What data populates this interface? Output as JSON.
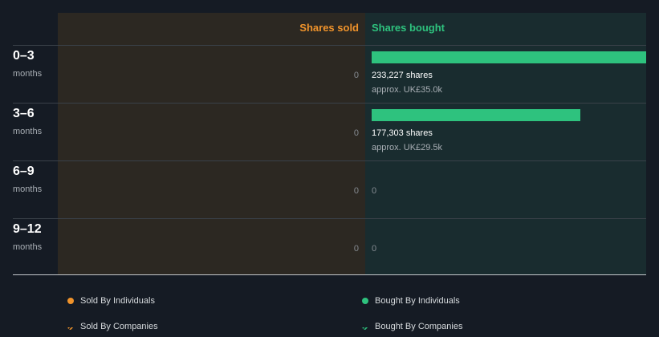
{
  "colors": {
    "sold": "#f0932b",
    "bought": "#2ec27e"
  },
  "chart_data": {
    "type": "bar",
    "orientation": "horizontal",
    "headers": {
      "sold": "Shares sold",
      "bought": "Shares bought"
    },
    "categories": [
      {
        "label": "0–3",
        "sub": "months"
      },
      {
        "label": "3–6",
        "sub": "months"
      },
      {
        "label": "6–9",
        "sub": "months"
      },
      {
        "label": "9–12",
        "sub": "months"
      }
    ],
    "series": [
      {
        "name": "Shares sold",
        "values": [
          0,
          0,
          0,
          0
        ]
      },
      {
        "name": "Shares bought",
        "values": [
          233227,
          177303,
          0,
          0
        ]
      }
    ],
    "sold_labels": [
      "0",
      "0",
      "0",
      "0"
    ],
    "bought_labels": [
      {
        "shares": "233,227 shares",
        "approx": "approx. UK£35.0k"
      },
      {
        "shares": "177,303 shares",
        "approx": "approx. UK£29.5k"
      },
      {
        "zero": "0"
      },
      {
        "zero": "0"
      }
    ],
    "legend": [
      {
        "label": "Sold By Individuals",
        "style": "dot",
        "color": "#f0932b"
      },
      {
        "label": "Bought By Individuals",
        "style": "dot",
        "color": "#2ec27e"
      },
      {
        "label": "Sold By Companies",
        "style": "hatch",
        "color": "#f0932b"
      },
      {
        "label": "Bought By Companies",
        "style": "hatch",
        "color": "#2ec27e"
      }
    ]
  }
}
